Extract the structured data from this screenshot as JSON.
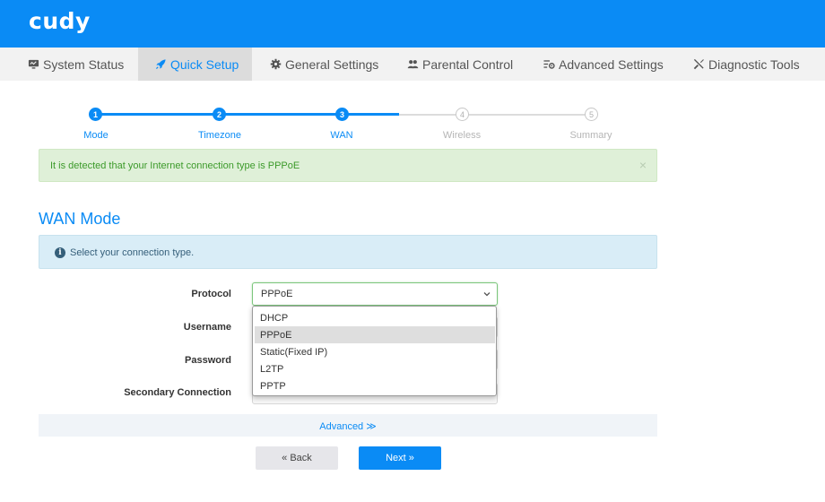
{
  "brand": {
    "logo_text": "cudy",
    "primary_color": "#0a8bf5"
  },
  "nav": {
    "items": [
      {
        "label": "System Status",
        "icon": "monitor-icon"
      },
      {
        "label": "Quick Setup",
        "icon": "rocket-icon",
        "active": true
      },
      {
        "label": "General Settings",
        "icon": "gear-icon"
      },
      {
        "label": "Parental Control",
        "icon": "users-icon"
      },
      {
        "label": "Advanced Settings",
        "icon": "sliders-gear-icon"
      },
      {
        "label": "Diagnostic Tools",
        "icon": "wrench-screwdriver-icon"
      }
    ]
  },
  "wizard": {
    "steps": [
      {
        "number": "1",
        "label": "Mode",
        "state": "done"
      },
      {
        "number": "2",
        "label": "Timezone",
        "state": "done"
      },
      {
        "number": "3",
        "label": "WAN",
        "state": "current"
      },
      {
        "number": "4",
        "label": "Wireless",
        "state": "todo"
      },
      {
        "number": "5",
        "label": "Summary",
        "state": "todo"
      }
    ]
  },
  "alert": {
    "message": "It is detected that your Internet connection type is PPPoE",
    "close_glyph": "×"
  },
  "section": {
    "title": "WAN Mode"
  },
  "info": {
    "message": "Select your connection type.",
    "icon_glyph": "i"
  },
  "form": {
    "protocol_label": "Protocol",
    "protocol_value": "PPPoE",
    "username_label": "Username",
    "password_label": "Password",
    "secondary_label": "Secondary Connection",
    "protocol_options": [
      "DHCP",
      "PPPoE",
      "Static(Fixed IP)",
      "L2TP",
      "PPTP"
    ],
    "selected_option": "PPPoE"
  },
  "advanced": {
    "label": "Advanced ≫"
  },
  "buttons": {
    "back": "« Back",
    "next": "Next »"
  }
}
